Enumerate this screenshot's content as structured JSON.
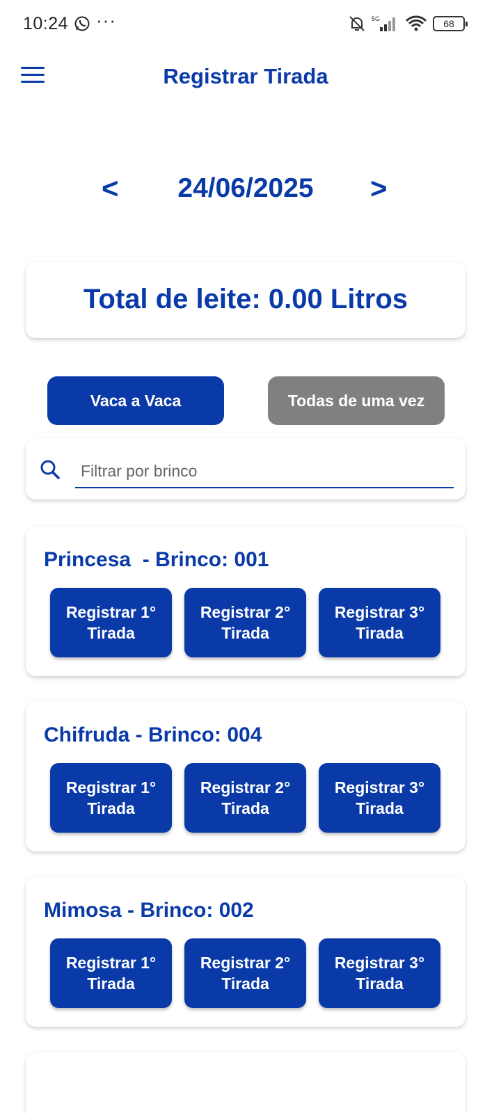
{
  "status_bar": {
    "time": "10:24",
    "dots": "···",
    "battery": "68",
    "icons": [
      "whatsapp-icon",
      "bell-muted-icon",
      "signal-5g-icon",
      "wifi-icon",
      "battery-icon"
    ]
  },
  "app_bar": {
    "title": "Registrar Tirada",
    "menu_icon": "hamburger-menu-icon"
  },
  "date_nav": {
    "prev": "<",
    "date": "24/06/2025",
    "next": ">"
  },
  "total": {
    "text": "Total de leite: 0.00 Litros"
  },
  "modes": {
    "active": "Vaca a Vaca",
    "inactive": "Todas de uma vez"
  },
  "search": {
    "placeholder": "Filtrar por brinco",
    "value": ""
  },
  "cows": [
    {
      "title": "Princesa  - Brinco: 001",
      "buttons": [
        {
          "line1": "Registrar 1°",
          "line2": "Tirada"
        },
        {
          "line1": "Registrar 2°",
          "line2": "Tirada"
        },
        {
          "line1": "Registrar 3°",
          "line2": "Tirada"
        }
      ]
    },
    {
      "title": "Chifruda - Brinco: 004",
      "buttons": [
        {
          "line1": "Registrar 1°",
          "line2": "Tirada"
        },
        {
          "line1": "Registrar 2°",
          "line2": "Tirada"
        },
        {
          "line1": "Registrar 3°",
          "line2": "Tirada"
        }
      ]
    },
    {
      "title": "Mimosa - Brinco: 002",
      "buttons": [
        {
          "line1": "Registrar 1°",
          "line2": "Tirada"
        },
        {
          "line1": "Registrar 2°",
          "line2": "Tirada"
        },
        {
          "line1": "Registrar 3°",
          "line2": "Tirada"
        }
      ]
    }
  ],
  "colors": {
    "primary": "#0a3aa8",
    "inactive": "#808080",
    "background": "#ffffff"
  }
}
